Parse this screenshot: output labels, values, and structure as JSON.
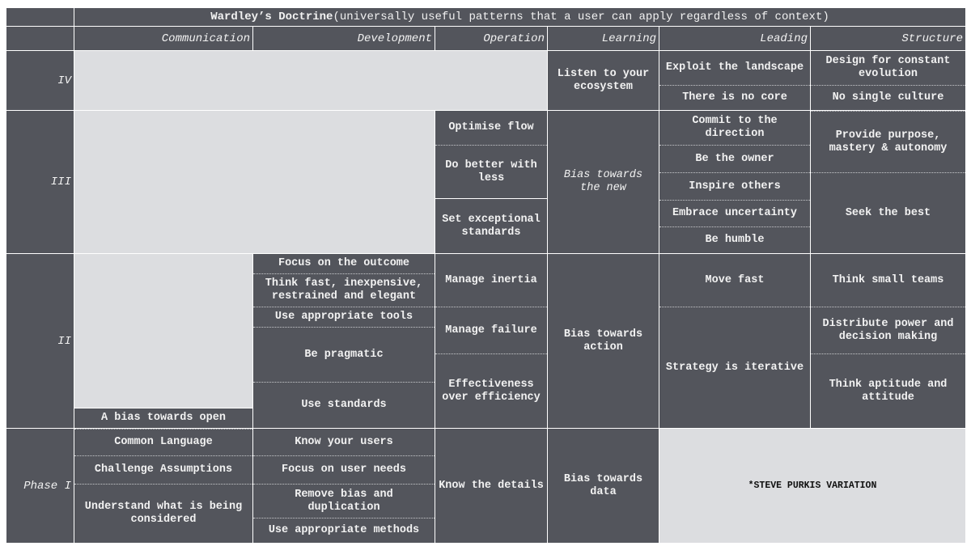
{
  "title": {
    "bold": "Wardley’s Doctrine",
    "rest": " (universally useful patterns that a user can apply regardless of context)"
  },
  "categories": [
    "Communication",
    "Development",
    "Operation",
    "Learning",
    "Leading",
    "Structure"
  ],
  "phases": [
    "IV",
    "III",
    "II",
    "Phase I"
  ],
  "cells": {
    "learning_iv": "Listen to your ecosystem",
    "leading_iv_1": "Exploit the landscape",
    "leading_iv_2": "There is no core",
    "structure_iv_1": "Design for constant evolution",
    "structure_iv_2": "No single culture",
    "operation_iii_1": "Optimise flow",
    "operation_iii_2": "Do better with less",
    "operation_iii_3": "Set exceptional standards",
    "learning_iii": "Bias towards the new",
    "leading_iii_1": "Commit to the direction",
    "leading_iii_2": "Be the owner",
    "leading_iii_3": "Inspire others",
    "leading_iii_4": "Embrace uncertainty",
    "leading_iii_5": "Be humble",
    "structure_iii_1": "Provide purpose, mastery & autonomy",
    "structure_iii_2": "Seek the best",
    "communication_ii": "A bias towards open",
    "development_ii_1": "Focus on the outcome",
    "development_ii_2": "Think fast, inexpensive, restrained and elegant",
    "development_ii_3": "Use appropriate tools",
    "development_ii_4": "Be pragmatic",
    "development_ii_5": "Use standards",
    "operation_ii_1": "Manage inertia",
    "operation_ii_2": "Manage failure",
    "operation_ii_3": "Effectiveness over efficiency",
    "learning_ii": "Bias towards action",
    "leading_ii_1": "Move fast",
    "leading_ii_2": "Strategy is iterative",
    "structure_ii_1": "Think small teams",
    "structure_ii_2": "Distribute power and decision making",
    "structure_ii_3": "Think aptitude and attitude",
    "communication_i_1": "Common Language",
    "communication_i_2": "Challenge Assumptions",
    "communication_i_3": "Understand what is being considered",
    "development_i_1": "Know your users",
    "development_i_2": "Focus on user needs",
    "development_i_3": "Remove bias and duplication",
    "development_i_4": "Use appropriate methods",
    "operation_i": "Know the details",
    "learning_i": "Bias towards data"
  },
  "note": "*STEVE PURKIS VARIATION",
  "colors": {
    "cell": "#53555c",
    "empty": "#dcdde0",
    "text": "#f2f2f2"
  }
}
